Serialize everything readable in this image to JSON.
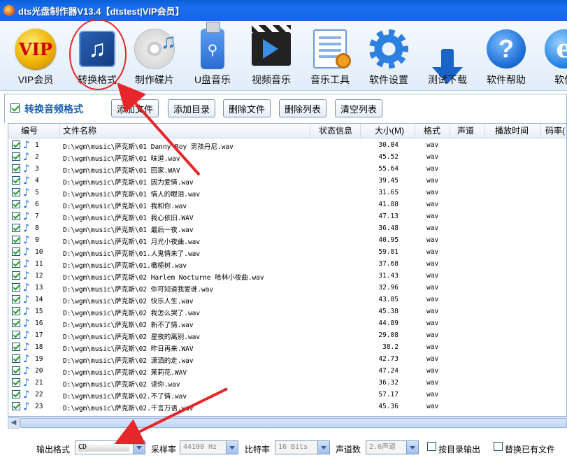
{
  "window": {
    "title": "dts光盘制作器V13.4【dtstest|VIP会员】"
  },
  "toolbar": {
    "items": [
      {
        "label": "VIP会员",
        "icon": "vip-icon"
      },
      {
        "label": "转换格式",
        "icon": "music-note-icon"
      },
      {
        "label": "制作碟片",
        "icon": "disc-icon"
      },
      {
        "label": "U盘音乐",
        "icon": "usb-icon"
      },
      {
        "label": "视频音乐",
        "icon": "clapboard-icon"
      },
      {
        "label": "音乐工具",
        "icon": "tools-icon"
      },
      {
        "label": "软件设置",
        "icon": "gear-icon"
      },
      {
        "label": "测试下载",
        "icon": "download-arrow-icon"
      },
      {
        "label": "软件帮助",
        "icon": "help-icon"
      },
      {
        "label": "软件",
        "icon": "ie-icon"
      }
    ],
    "vip_text": "VIP",
    "help_glyph": "?",
    "ie_glyph": "e"
  },
  "section": {
    "title": "转换音频格式",
    "checked": true,
    "buttons": {
      "add_file": "添加文件",
      "add_dir": "添加目录",
      "delete_file": "删除文件",
      "delete_list": "删除列表",
      "clear_list": "清空列表"
    }
  },
  "table": {
    "columns": {
      "num": "编号",
      "name": "文件名称",
      "status": "状态信息",
      "size": "大小(M)",
      "format": "格式",
      "channels": "声道",
      "duration": "播放时间",
      "bitrate": "码率("
    },
    "rows": [
      {
        "num": "1",
        "file": "D:\\wgm\\music\\萨克斯\\01 Danny Boy 男孩丹尼.wav",
        "size": "30.04",
        "format": "wav"
      },
      {
        "num": "2",
        "file": "D:\\wgm\\music\\萨克斯\\01 味道.wav",
        "size": "45.52",
        "format": "wav"
      },
      {
        "num": "3",
        "file": "D:\\wgm\\music\\萨克斯\\01 回家.WAV",
        "size": "55.64",
        "format": "wav"
      },
      {
        "num": "4",
        "file": "D:\\wgm\\music\\萨克斯\\01 因为爱情.wav",
        "size": "39.45",
        "format": "wav"
      },
      {
        "num": "5",
        "file": "D:\\wgm\\music\\萨克斯\\01 情人的眼泪.wav",
        "size": "31.65",
        "format": "wav"
      },
      {
        "num": "6",
        "file": "D:\\wgm\\music\\萨克斯\\01 我和你.wav",
        "size": "41.88",
        "format": "wav"
      },
      {
        "num": "7",
        "file": "D:\\wgm\\music\\萨克斯\\01 我心依旧.WAV",
        "size": "47.13",
        "format": "wav"
      },
      {
        "num": "8",
        "file": "D:\\wgm\\music\\萨克斯\\01 最后一夜.wav",
        "size": "36.48",
        "format": "wav"
      },
      {
        "num": "9",
        "file": "D:\\wgm\\music\\萨克斯\\01 月光小夜曲.wav",
        "size": "40.95",
        "format": "wav"
      },
      {
        "num": "10",
        "file": "D:\\wgm\\music\\萨克斯\\01.人鬼情未了.wav",
        "size": "59.81",
        "format": "wav"
      },
      {
        "num": "11",
        "file": "D:\\wgm\\music\\萨克斯\\01.橄榄树.wav",
        "size": "37.68",
        "format": "wav"
      },
      {
        "num": "12",
        "file": "D:\\wgm\\music\\萨克斯\\02 Harlem Nocturne 哈林小夜曲.wav",
        "size": "31.43",
        "format": "wav"
      },
      {
        "num": "13",
        "file": "D:\\wgm\\music\\萨克斯\\02 你可知道我爱谁.wav",
        "size": "32.96",
        "format": "wav"
      },
      {
        "num": "14",
        "file": "D:\\wgm\\music\\萨克斯\\02 快乐人生.wav",
        "size": "43.85",
        "format": "wav"
      },
      {
        "num": "15",
        "file": "D:\\wgm\\music\\萨克斯\\02 我怎么哭了.wav",
        "size": "45.38",
        "format": "wav"
      },
      {
        "num": "16",
        "file": "D:\\wgm\\music\\萨克斯\\02 新不了情.wav",
        "size": "44.89",
        "format": "wav"
      },
      {
        "num": "17",
        "file": "D:\\wgm\\music\\萨克斯\\02 星夜的离别.wav",
        "size": "29.08",
        "format": "wav"
      },
      {
        "num": "18",
        "file": "D:\\wgm\\music\\萨克斯\\02 昨日再来.WAV",
        "size": "38.2",
        "format": "wav"
      },
      {
        "num": "19",
        "file": "D:\\wgm\\music\\萨克斯\\02 潇洒的走.wav",
        "size": "42.73",
        "format": "wav"
      },
      {
        "num": "20",
        "file": "D:\\wgm\\music\\萨克斯\\02 茉莉花.WAV",
        "size": "47.24",
        "format": "wav"
      },
      {
        "num": "21",
        "file": "D:\\wgm\\music\\萨克斯\\02 读你.wav",
        "size": "36.32",
        "format": "wav"
      },
      {
        "num": "22",
        "file": "D:\\wgm\\music\\萨克斯\\02.不了情.wav",
        "size": "57.17",
        "format": "wav"
      },
      {
        "num": "23",
        "file": "D:\\wgm\\music\\萨克斯\\02.千言万语.wav",
        "size": "45.36",
        "format": "wav"
      }
    ]
  },
  "output": {
    "format_label": "输出格式",
    "format_value": "CD",
    "samplerate_label": "采样率",
    "samplerate_value": "44100 Hz",
    "bitrate_label": "比特率",
    "bitrate_value": "16 Bits",
    "channels_label": "声道数",
    "channels_value": "2.0声道",
    "dir_output_label": "按目录输出",
    "replace_label": "替换已有文件"
  },
  "colors": {
    "titlebar": "#1a6ff0",
    "highlight": "#e6262a",
    "accent": "#1a5fb4"
  }
}
